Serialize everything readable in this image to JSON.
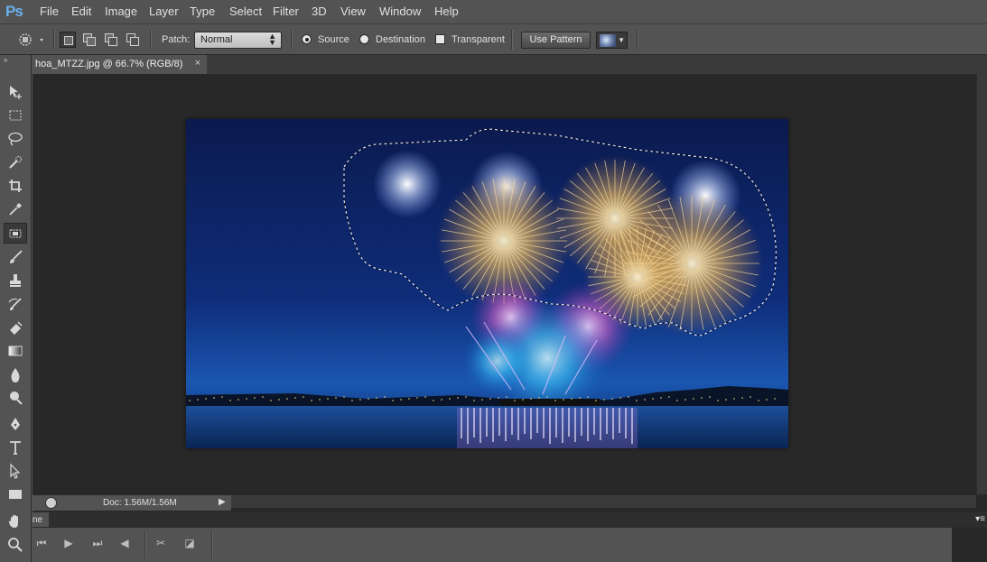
{
  "app": {
    "logo": "Ps"
  },
  "menu": [
    "File",
    "Edit",
    "Image",
    "Layer",
    "Type",
    "Select",
    "Filter",
    "3D",
    "View",
    "Window",
    "Help"
  ],
  "options": {
    "tool_icon": "patch-tool-icon",
    "patch_label": "Patch:",
    "patch_value": "Normal",
    "source_label": "Source",
    "destination_label": "Destination",
    "transparent_label": "Transparent",
    "use_pattern_label": "Use Pattern",
    "source_selected": true,
    "transparent_checked": false
  },
  "document": {
    "tab_title": "hoa_MTZZ.jpg @ 66.7% (RGB/8)",
    "close_glyph": "×"
  },
  "tools": [
    "move-tool-icon",
    "marquee-tool-icon",
    "lasso-tool-icon",
    "quick-selection-tool-icon",
    "crop-tool-icon",
    "eyedropper-tool-icon",
    "patch-tool-icon",
    "brush-tool-icon",
    "clone-stamp-tool-icon",
    "history-brush-tool-icon",
    "eraser-tool-icon",
    "gradient-tool-icon",
    "blur-tool-icon",
    "dodge-tool-icon",
    "pen-tool-icon",
    "type-tool-icon",
    "path-selection-tool-icon",
    "rectangle-tool-icon",
    "hand-tool-icon",
    "zoom-tool-icon"
  ],
  "status": {
    "doc": "Doc: 1.56M/1.56M"
  },
  "timeline": {
    "title": "ne"
  },
  "colors": {
    "background": "#535353",
    "canvas": "#282828",
    "accent": "#6ab0ee"
  }
}
